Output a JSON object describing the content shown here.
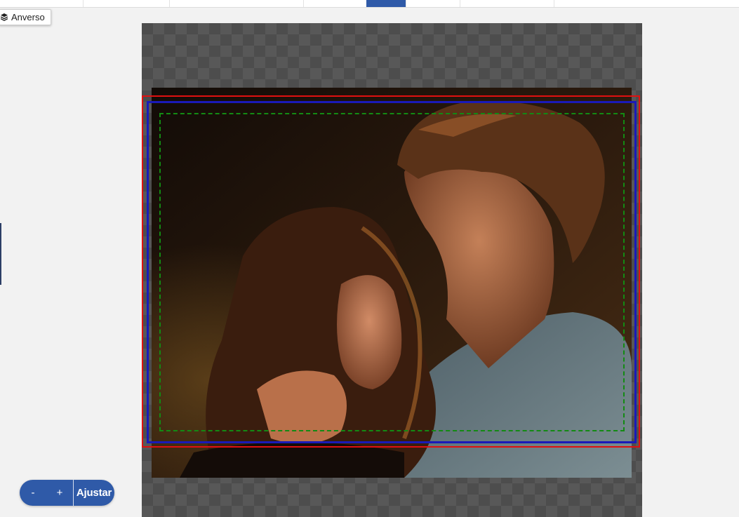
{
  "side_panel": {
    "layer_label": "Anverso",
    "layer_icon": "layers-icon"
  },
  "zoom_controls": {
    "minus_label": "-",
    "plus_label": "+",
    "fit_label": "Ajustar"
  },
  "guides": {
    "bleed_color": "#e01010",
    "trim_color": "#1a1ab8",
    "safe_color": "#138a13"
  },
  "colors": {
    "accent": "#2f5aa8"
  }
}
